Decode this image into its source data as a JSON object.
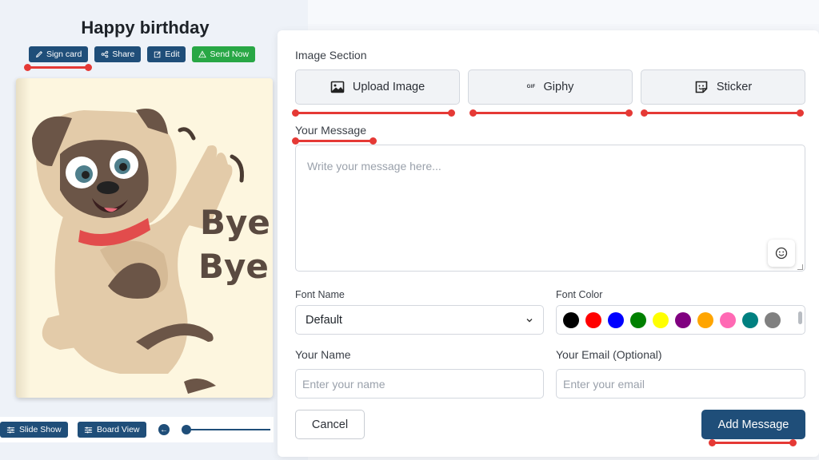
{
  "card": {
    "title": "Happy birthday",
    "actions": [
      {
        "label": "Sign card",
        "icon": "pencil-icon",
        "color": "#1f4e79"
      },
      {
        "label": "Share",
        "icon": "share-icon",
        "color": "#1f4e79"
      },
      {
        "label": "Edit",
        "icon": "edit-icon",
        "color": "#1f4e79"
      },
      {
        "label": "Send Now",
        "icon": "send-icon",
        "color": "#28a745"
      }
    ],
    "image_text": [
      "Bye",
      "Bye"
    ]
  },
  "bottom": {
    "slide_show": "Slide Show",
    "board_view": "Board View",
    "slider_value": 0
  },
  "form": {
    "image_section_label": "Image Section",
    "tabs": [
      {
        "label": "Upload Image",
        "icon": "image-icon"
      },
      {
        "label": "Giphy",
        "icon": "gif-icon",
        "badge": "GIF"
      },
      {
        "label": "Sticker",
        "icon": "sticker-icon"
      }
    ],
    "message_label": "Your Message",
    "message_placeholder": "Write your message here...",
    "font_name_label": "Font Name",
    "font_name_value": "Default",
    "font_color_label": "Font Color",
    "font_colors": [
      "#000000",
      "#ff0000",
      "#0000ff",
      "#008000",
      "#ffff00",
      "#800080",
      "#ffa500",
      "#ff69b4",
      "#008080",
      "#808080"
    ],
    "name_label": "Your Name",
    "name_placeholder": "Enter your name",
    "email_label": "Your Email (Optional)",
    "email_placeholder": "Enter your email",
    "cancel_label": "Cancel",
    "add_label": "Add Message"
  },
  "colors": {
    "primary": "#1f4e79",
    "success": "#28a745",
    "highlight": "#e53935"
  }
}
